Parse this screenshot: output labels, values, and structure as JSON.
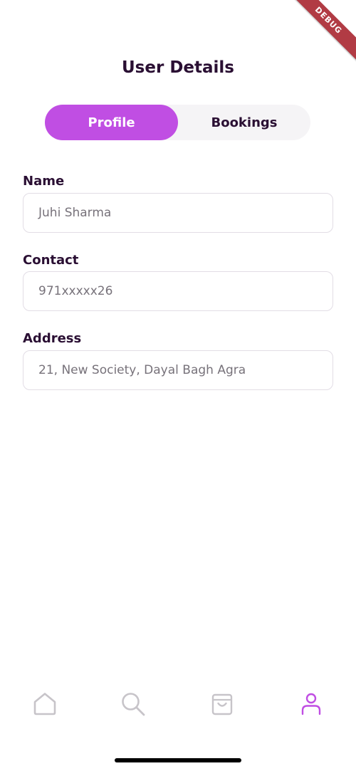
{
  "debug_banner": "DEBUG",
  "header": {
    "title": "User Details"
  },
  "tabs": [
    {
      "label": "Profile",
      "active": true
    },
    {
      "label": "Bookings",
      "active": false
    }
  ],
  "form": {
    "name": {
      "label": "Name",
      "value": "Juhi Sharma"
    },
    "contact": {
      "label": "Contact",
      "value": "971xxxxx26"
    },
    "address": {
      "label": "Address",
      "value": "21, New Society, Dayal Bagh Agra"
    }
  },
  "bottom_nav": [
    {
      "icon": "home-icon",
      "active": false
    },
    {
      "icon": "search-icon",
      "active": false
    },
    {
      "icon": "shopping-bag-icon",
      "active": false
    },
    {
      "icon": "user-icon",
      "active": true
    }
  ],
  "colors": {
    "accent": "#c04ee3",
    "title_text": "#2a0f33",
    "inactive_icon": "#c7c4c9",
    "debug_banner": "#b13b44"
  }
}
